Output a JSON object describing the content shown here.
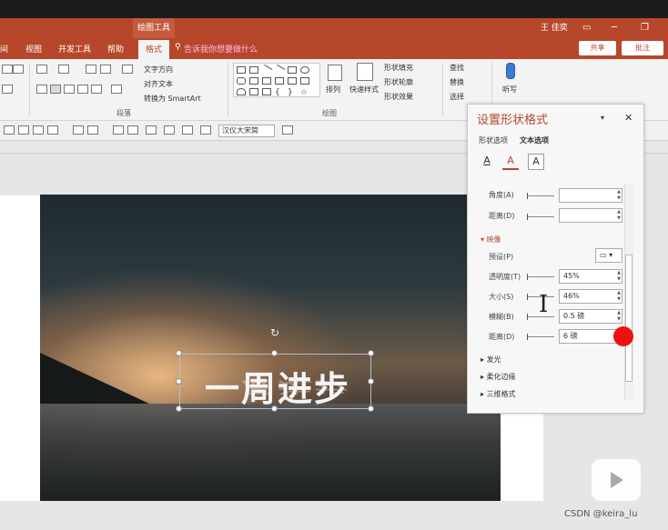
{
  "titlebar": {
    "context_tab": "绘图工具",
    "user": "王 佳奕"
  },
  "menu": {
    "items": [
      "间",
      "视图",
      "开发工具",
      "帮助",
      "格式"
    ],
    "tellme": "告诉我你想要做什么",
    "share": "共享",
    "comment": "批注"
  },
  "ribbon": {
    "text_direction": "文字方向",
    "align_text": "对齐文本",
    "convert_smartart": "转换为 SmartArt",
    "paragraph_group": "段落",
    "drawing_group": "绘图",
    "arrange": "排列",
    "quick_styles": "快速样式",
    "shape_fill": "形状填充",
    "shape_outline": "形状轮廓",
    "shape_effects": "形状效果",
    "find": "查找",
    "replace": "替换",
    "select": "选择",
    "dictate": "听写"
  },
  "toolbar2": {
    "font": "汉仪大宋简"
  },
  "slide": {
    "title": "一周进步"
  },
  "pane": {
    "title": "设置形状格式",
    "tab_shape": "形状选项",
    "tab_text": "文本选项",
    "angle_label": "角度(A)",
    "distance_label_top": "距离(D)",
    "reflection_section": "映像",
    "preset_label": "预设(P)",
    "transparency_label": "透明度(T)",
    "transparency_value": "45%",
    "size_label": "大小(S)",
    "size_value": "46%",
    "blur_label": "模糊(B)",
    "blur_value": "0.5 磅",
    "distance_label": "距离(D)",
    "distance_value": "6 磅",
    "glow": "发光",
    "soft_edges": "柔化边缘",
    "three_d": "三维格式"
  },
  "watermark": "CSDN @keira_lu",
  "colors": {
    "accent": "#b7472a",
    "pane_title": "#b7472a",
    "red_dot": "#ee1111"
  }
}
